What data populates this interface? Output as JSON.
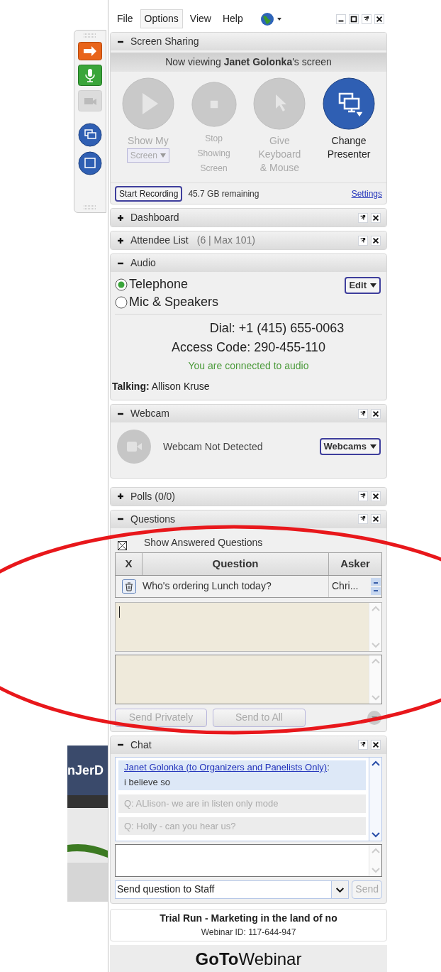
{
  "menu": [
    {
      "label": "File",
      "selected": false
    },
    {
      "label": "Options",
      "selected": true
    },
    {
      "label": "View",
      "selected": false
    },
    {
      "label": "Help",
      "selected": false
    }
  ],
  "background": {
    "fragment": "nJerD"
  },
  "screen_sharing": {
    "title": "Screen Sharing",
    "expanded": true,
    "banner": "Now viewing **Janet Golonka**'s screen",
    "actions": [
      {
        "kind": "play",
        "lines": [
          "Show My"
        ],
        "dropdown": "Screen",
        "disabled": true
      },
      {
        "kind": "stop",
        "lines": [
          "Stop",
          "Showing",
          "Screen"
        ],
        "disabled": true
      },
      {
        "kind": "pointer",
        "lines": [
          "Give",
          "Keyboard",
          "& Mouse"
        ],
        "disabled": true
      },
      {
        "kind": "presenter",
        "lines": [
          "Change",
          "Presenter"
        ],
        "disabled": false
      }
    ],
    "record_button": "Start Recording",
    "storage": "45.7 GB remaining",
    "settings_link": "Settings"
  },
  "dashboard": {
    "title": "Dashboard",
    "expanded": false
  },
  "attendees": {
    "title": "Attendee List",
    "count": "(6 | Max 101)",
    "expanded": false
  },
  "audio": {
    "title": "Audio",
    "expanded": true,
    "options": [
      {
        "label": "Telephone",
        "selected": true
      },
      {
        "label": "Mic & Speakers",
        "selected": false
      }
    ],
    "edit_button": "Edit",
    "dial": "Dial: +1 (415) 655-0063",
    "access_code": "Access Code: 290-455-110",
    "status": "You are connected to audio",
    "talking": "**Talking:** Allison Kruse"
  },
  "webcam": {
    "title": "Webcam",
    "expanded": true,
    "status": "Webcam Not Detected",
    "button": "Webcams"
  },
  "polls": {
    "title": "Polls (0/0)",
    "expanded": false
  },
  "questions": {
    "title": "Questions",
    "expanded": true,
    "show_answered": {
      "label": "Show Answered Questions",
      "checked": true
    },
    "columns": [
      "X",
      "Question",
      "Asker"
    ],
    "rows": [
      {
        "question": "Who's ordering Lunch today?",
        "asker": "Chri..."
      }
    ],
    "buttons": [
      {
        "label": "Send Privately",
        "disabled": true
      },
      {
        "label": "Send to All",
        "disabled": true
      }
    ]
  },
  "chat": {
    "title": "Chat",
    "expanded": true,
    "messages": [
      {
        "kind": "author",
        "text": "Janet Golonka (to Organizers and Panelists Only)",
        "suffix": ":",
        "body": "i believe so"
      },
      {
        "kind": "question",
        "text": "Q: ALlison- we are in listen only mode"
      },
      {
        "kind": "question",
        "text": "Q: Holly - can you hear us?"
      }
    ],
    "send_target": "Send question to Staff",
    "send_button": "Send",
    "send_disabled": true
  },
  "footer": {
    "title": "Trial Run - Marketing in the land of no",
    "webinar_id": "Webinar ID: 117-644-947",
    "logo_bold": "GoTo",
    "logo_light": "Webinar"
  }
}
